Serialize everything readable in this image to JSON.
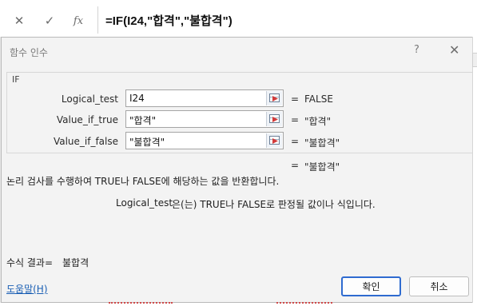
{
  "formula_bar": {
    "cancel_icon": "close-icon",
    "enter_icon": "check-icon",
    "fx_label": "fx",
    "formula": "=IF(I24,\"합격\",\"불합격\")"
  },
  "dialog": {
    "title": "함수 인수",
    "help_glyph": "?",
    "close_glyph": "✕",
    "function_name": "IF",
    "arguments": [
      {
        "label": "Logical_test",
        "value": "I24",
        "eq": "=",
        "result": "FALSE"
      },
      {
        "label": "Value_if_true",
        "value": "\"합격\"",
        "eq": "=",
        "result": "\"합격\""
      },
      {
        "label": "Value_if_false",
        "value": "\"불합격\"",
        "eq": "=",
        "result": "\"불합격\""
      }
    ],
    "overall_eq": "=",
    "overall_result": "\"불합격\"",
    "description": "논리 검사를 수행하여 TRUE나 FALSE에 해당하는 값을 반환합니다.",
    "arg_desc_name": "Logical_test",
    "arg_desc_text": "은(는) TRUE나 FALSE로 판정될 값이나 식입니다.",
    "formula_result_label": "수식 결과=",
    "formula_result_value": "불합격",
    "help_link": "도움말(H)",
    "ok_label": "확인",
    "cancel_label": "취소"
  },
  "colors": {
    "link": "#1a5fb4",
    "ok_border": "#2e6bd0",
    "dialog_bg": "#f3f3f3"
  }
}
